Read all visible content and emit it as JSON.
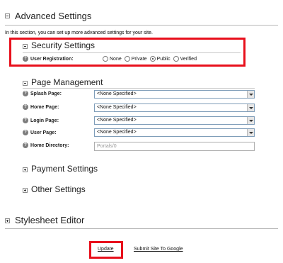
{
  "advanced": {
    "title": "Advanced Settings",
    "description": "In this section, you can set up more advanced settings for your site."
  },
  "security": {
    "title": "Security Settings",
    "user_registration_label": "User Registration:",
    "options": [
      "None",
      "Private",
      "Public",
      "Verified"
    ],
    "selected": "Public"
  },
  "page_management": {
    "title": "Page Management",
    "splash_label": "Splash Page:",
    "home_label": "Home Page:",
    "login_label": "Login Page:",
    "user_label": "User Page:",
    "home_dir_label": "Home Directory:",
    "splash_value": "<None Specified>",
    "home_value": "<None Specified>",
    "login_value": "<None Specified>",
    "user_value": "<None Specified>",
    "home_dir_value": "Portals/0"
  },
  "payment": {
    "title": "Payment Settings"
  },
  "other": {
    "title": "Other Settings"
  },
  "stylesheet": {
    "title": "Stylesheet Editor"
  },
  "actions": {
    "update": "Update",
    "submit_google": "Submit Site To Google"
  },
  "colors": {
    "highlight": "#e8101c",
    "rule": "#b9b9b9",
    "select_border": "#7f9db9"
  },
  "icons": [
    "collapse-icon",
    "expand-icon",
    "help-icon",
    "dropdown-arrow-icon"
  ]
}
